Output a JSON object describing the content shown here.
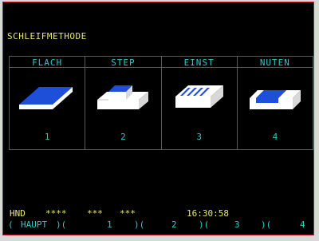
{
  "screen": {
    "title": "SCHLEIFMETHODE"
  },
  "methods": [
    {
      "label": "FLACH",
      "number": "1",
      "icon": "flat-grinding-icon"
    },
    {
      "label": "STEP",
      "number": "2",
      "icon": "step-grinding-icon"
    },
    {
      "label": "EINST",
      "number": "3",
      "icon": "plunge-grinding-icon"
    },
    {
      "label": "NUTEN",
      "number": "4",
      "icon": "slot-grinding-icon"
    }
  ],
  "status": {
    "mode": "HND",
    "stars1": "****",
    "stars2": "***",
    "stars3": "***",
    "time": "16:30:58"
  },
  "softkeys": {
    "open_paren": "(",
    "haupt": "HAUPT",
    "sep": ")(",
    "key1": "1",
    "key2": "2",
    "key3": "3",
    "key4": "4"
  },
  "colors": {
    "yellow": "#e8e86a",
    "cyan": "#2fc7c7",
    "blue": "#1e4fd8",
    "white": "#ffffff",
    "frame": "#c0202a"
  }
}
